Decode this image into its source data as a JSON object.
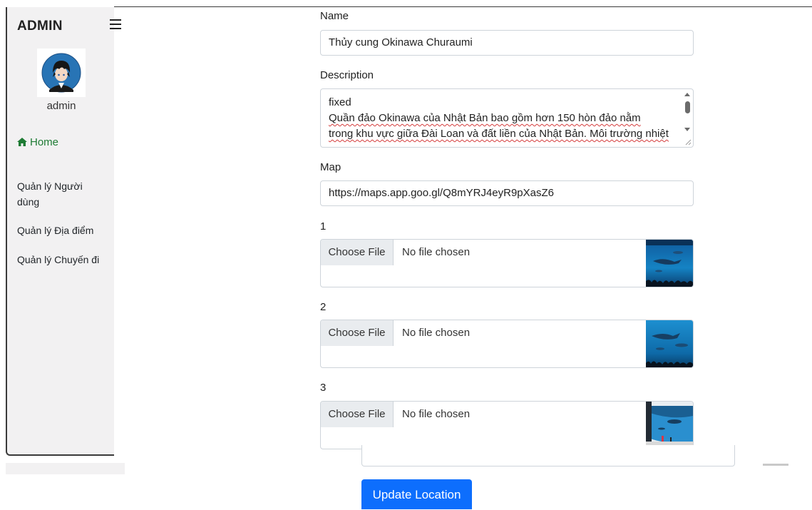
{
  "sidebar": {
    "brand": "ADMIN",
    "username": "admin",
    "home_label": "Home",
    "items": [
      {
        "label": "Quản lý Người dùng"
      },
      {
        "label": "Quản lý Địa điểm"
      },
      {
        "label": "Quản lý Chuyến đi"
      }
    ],
    "icons": [
      "hamburger-icon",
      "house-icon",
      "avatar-image"
    ]
  },
  "form": {
    "name_label": "Name",
    "name_value": "Thủy cung Okinawa Churaumi",
    "description_label": "Description",
    "description_lines": [
      "fixed",
      "Quần đảo Okinawa của Nhật Bản bao gồm hơn 150 hòn đảo nằm",
      "trong khu vực giữa Đài Loan và đất liền của Nhật Bản. Môi trường nhiệt"
    ],
    "map_label": "Map",
    "map_value": "https://maps.app.goo.gl/Q8mYRJ4eyR9pXasZ6",
    "files": [
      {
        "label": "1",
        "button": "Choose File",
        "status": "No file chosen"
      },
      {
        "label": "2",
        "button": "Choose File",
        "status": "No file chosen"
      },
      {
        "label": "3",
        "button": "Choose File",
        "status": "No file chosen"
      }
    ],
    "submit_label": "Update Location"
  },
  "colors": {
    "sidebar_bg": "#f2f1f2",
    "home_active": "#1e7b34",
    "primary": "#0d6efd",
    "border": "#ced4da",
    "spellcheck": "#d43b3b"
  }
}
